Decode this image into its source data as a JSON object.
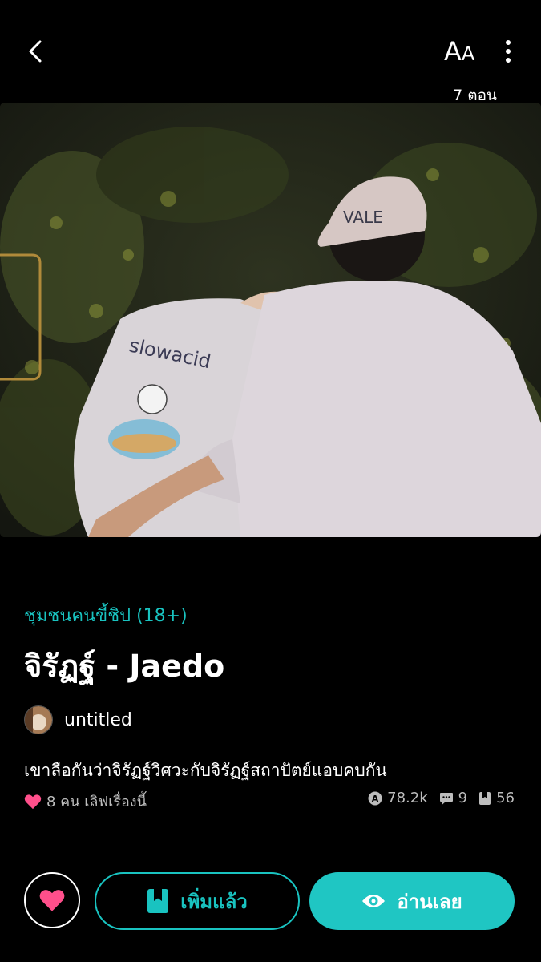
{
  "header": {
    "font_size_label_big": "A",
    "font_size_label_small": "A",
    "episodes": "7 ตอน"
  },
  "story": {
    "genre": "ชุมชนคนขี้ชิป (18+)",
    "title": "จิรัฏฐ์ - Jaedo",
    "author": "untitled",
    "description": "เขาลือกันว่าจิรัฏฐ์วิศวะกับจิรัฏฐ์สถาปัตย์แอบคบกัน",
    "likes_text": "8 คน เลิฟเรื่องนี้",
    "views": "78.2k",
    "comments": "9",
    "bookmarks": "56"
  },
  "actions": {
    "added_label": "เพิ่มแล้ว",
    "read_label": "อ่านเลย"
  },
  "colors": {
    "accent": "#19c3c0",
    "heart": "#ff4f8b",
    "background": "#000000"
  },
  "icons": [
    "back-icon",
    "font-size-icon",
    "more-icon",
    "heart-icon",
    "views-icon",
    "comment-icon",
    "bookmark-icon",
    "eye-icon"
  ]
}
